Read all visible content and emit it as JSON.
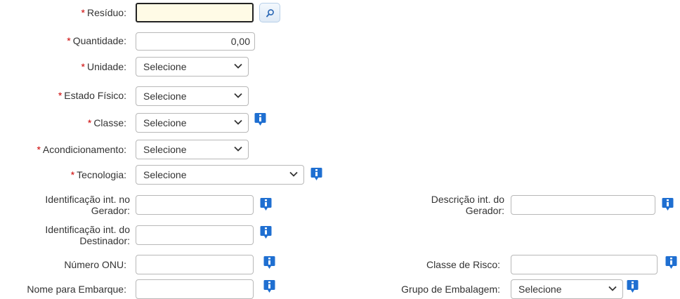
{
  "form": {
    "residuo": {
      "label": "Resíduo:",
      "required": "*",
      "value": ""
    },
    "quantidade": {
      "label": "Quantidade:",
      "required": "*",
      "value": "0,00"
    },
    "unidade": {
      "label": "Unidade:",
      "required": "*",
      "selected": "Selecione"
    },
    "estado_fisico": {
      "label": "Estado Físico:",
      "required": "*",
      "selected": "Selecione"
    },
    "classe": {
      "label": "Classe:",
      "required": "*",
      "selected": "Selecione"
    },
    "acondicionamento": {
      "label": "Acondicionamento:",
      "required": "*",
      "selected": "Selecione"
    },
    "tecnologia": {
      "label": "Tecnologia:",
      "required": "*",
      "selected": "Selecione"
    },
    "ident_gerador": {
      "label_line1": "Identificação int. no",
      "label_line2": "Gerador:",
      "value": ""
    },
    "descricao_gerador": {
      "label_line1": "Descrição int. do",
      "label_line2": "Gerador:",
      "value": ""
    },
    "ident_destinador": {
      "label_line1": "Identificação int. do",
      "label_line2": "Destinador:",
      "value": ""
    },
    "numero_onu": {
      "label": "Número ONU:",
      "value": ""
    },
    "classe_risco": {
      "label": "Classe de Risco:",
      "value": ""
    },
    "nome_embarque": {
      "label": "Nome para Embarque:",
      "value": ""
    },
    "grupo_embalagem": {
      "label": "Grupo de Embalagem:",
      "selected": "Selecione"
    }
  },
  "icons": {
    "search": "magnifier-icon",
    "info": "info-icon",
    "chevron": "chevron-down-icon"
  },
  "colors": {
    "required": "#cc0000",
    "info_blue": "#1f6fd1",
    "focus_bg": "#fffbe6"
  }
}
